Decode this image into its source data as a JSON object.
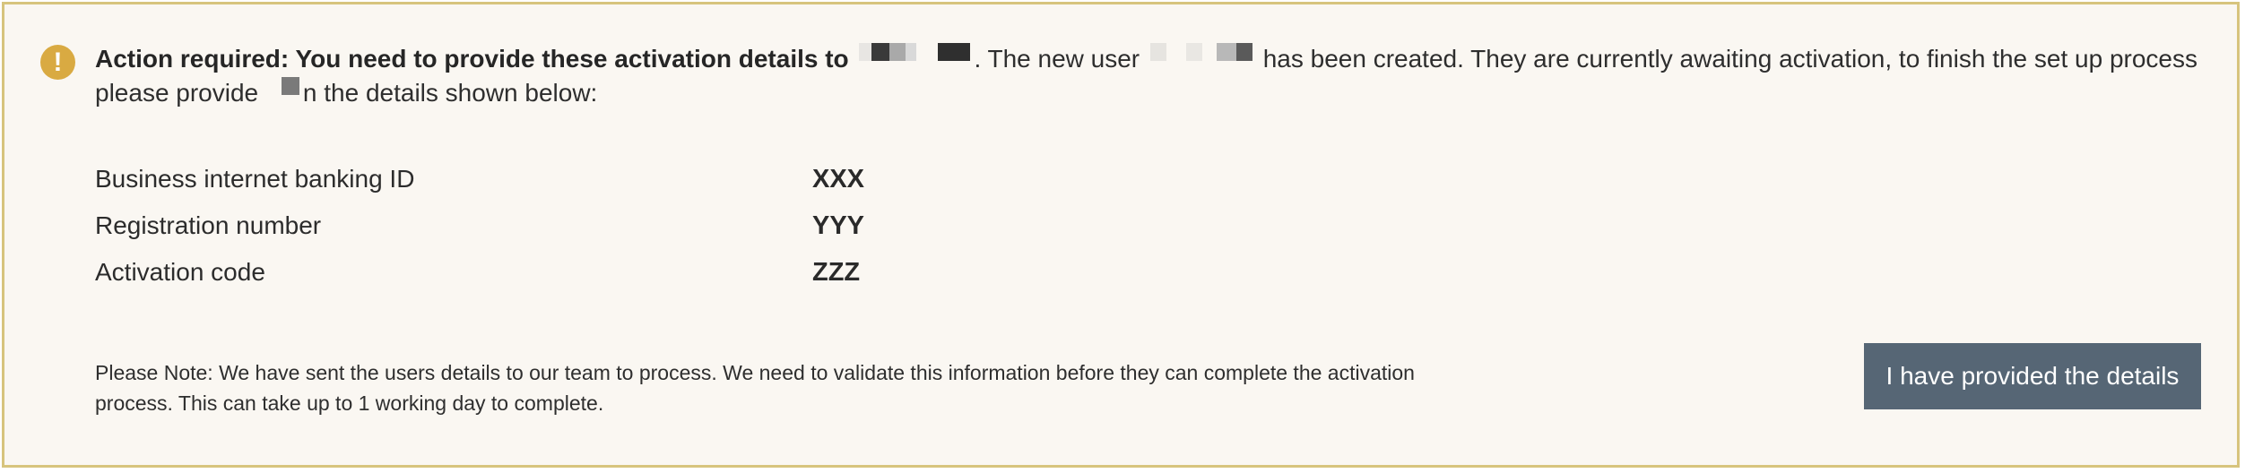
{
  "alert": {
    "icon": "!",
    "heading": "Action required: You need to provide these activation details to",
    "text_part1": ". The new user",
    "text_part2": "has been created. They are currently awaiting activation, to finish the set up process please provide",
    "text_part3": "n the details shown below:"
  },
  "details": [
    {
      "label": "Business internet banking ID",
      "value": "XXX"
    },
    {
      "label": "Registration number",
      "value": "YYY"
    },
    {
      "label": "Activation code",
      "value": "ZZZ"
    }
  ],
  "note": {
    "text": "Please Note: We have sent the users details to our team to process. We need to validate this information before they can complete the activation process. This can take up to 1 working day to complete."
  },
  "actions": {
    "confirm_label": "I have provided the details"
  },
  "colors": {
    "alert_border": "#d7c47d",
    "alert_background": "#faf7f2",
    "warning_icon": "#d9aa42",
    "button_background": "#566675",
    "button_text": "#ffffff"
  }
}
